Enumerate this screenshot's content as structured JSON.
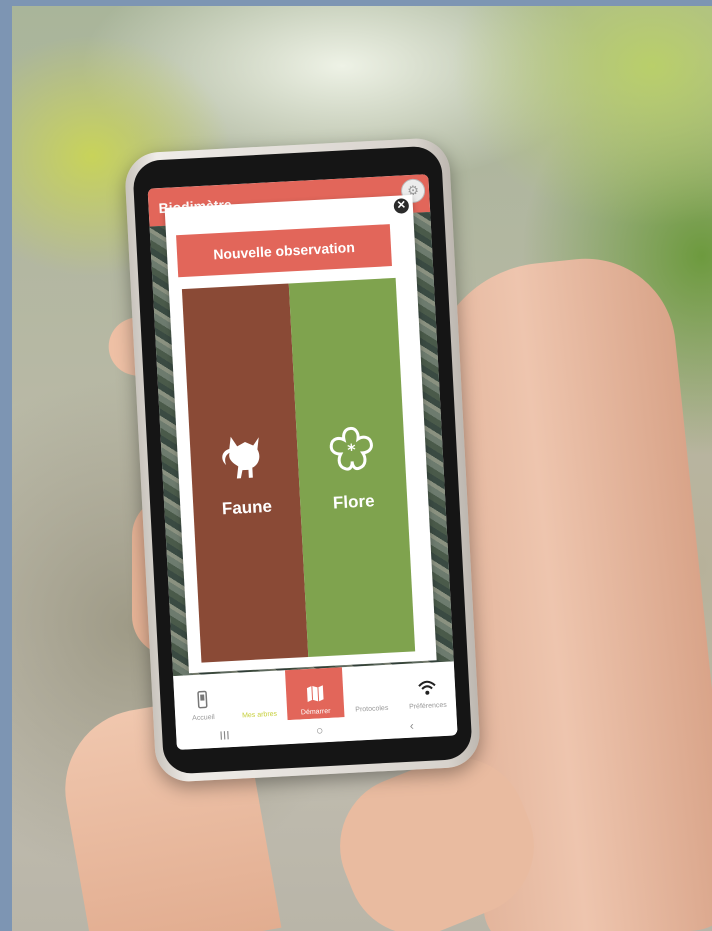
{
  "app": {
    "title": "Biodimètre"
  },
  "modal": {
    "title": "Nouvelle observation",
    "close_icon": "close-icon",
    "choices": [
      {
        "label": "Faune",
        "icon": "fox-icon",
        "color": "#8a4a36"
      },
      {
        "label": "Flore",
        "icon": "flower-icon",
        "color": "#7fa34e"
      }
    ]
  },
  "nav": {
    "items": [
      {
        "label": "Accueil",
        "icon": "phone-icon"
      },
      {
        "label": "Mes arbres",
        "icon": "tree-icon"
      },
      {
        "label": "Démarrer",
        "icon": "map-icon",
        "active": true
      },
      {
        "label": "Protocoles",
        "icon": "list-icon"
      },
      {
        "label": "Préférences",
        "icon": "wifi-icon"
      }
    ]
  },
  "system_bar": {
    "recent": "III",
    "home": "○",
    "back": "‹"
  },
  "colors": {
    "accent": "#e2665a",
    "faune": "#8a4a36",
    "flore": "#7fa34e"
  }
}
